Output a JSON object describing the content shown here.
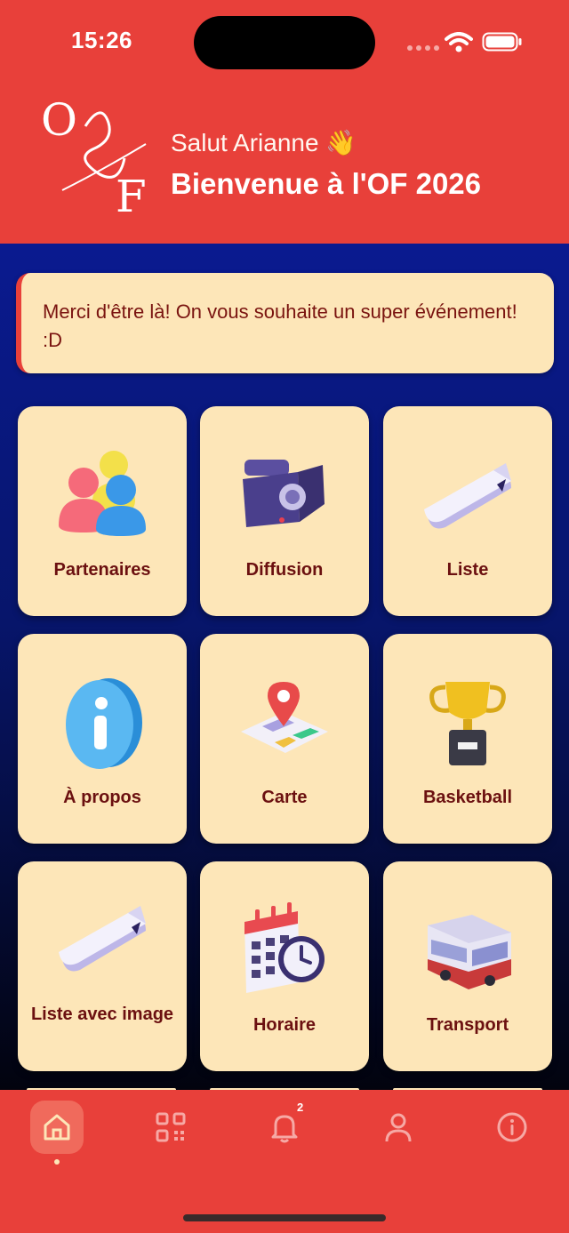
{
  "status": {
    "time": "15:26"
  },
  "header": {
    "greeting": "Salut Arianne 👋",
    "welcome": "Bienvenue à l'OF 2026",
    "logo_text": "O&F"
  },
  "notice": {
    "text": "Merci d'être là! On vous souhaite un super événement! :D"
  },
  "tiles": [
    {
      "label": "Partenaires",
      "icon": "users-group-icon"
    },
    {
      "label": "Diffusion",
      "icon": "video-camera-icon"
    },
    {
      "label": "Liste",
      "icon": "ticket-tag-icon"
    },
    {
      "label": "À propos",
      "icon": "info-icon"
    },
    {
      "label": "Carte",
      "icon": "map-pin-icon"
    },
    {
      "label": "Basketball",
      "icon": "trophy-icon"
    },
    {
      "label": "Liste avec image",
      "icon": "ticket-tag-icon"
    },
    {
      "label": "Horaire",
      "icon": "calendar-clock-icon"
    },
    {
      "label": "Transport",
      "icon": "bus-icon"
    }
  ],
  "tabbar": {
    "tabs": [
      {
        "name": "home",
        "icon": "home-icon",
        "active": true
      },
      {
        "name": "qr",
        "icon": "qr-code-icon"
      },
      {
        "name": "notifications",
        "icon": "bell-icon",
        "badge": "2"
      },
      {
        "name": "profile",
        "icon": "user-icon"
      },
      {
        "name": "info",
        "icon": "info-circle-icon"
      }
    ]
  },
  "colors": {
    "brand_red": "#e8403a",
    "tile_cream": "#fde6b8",
    "text_maroon": "#6b1010",
    "navy": "#0a1a90"
  }
}
